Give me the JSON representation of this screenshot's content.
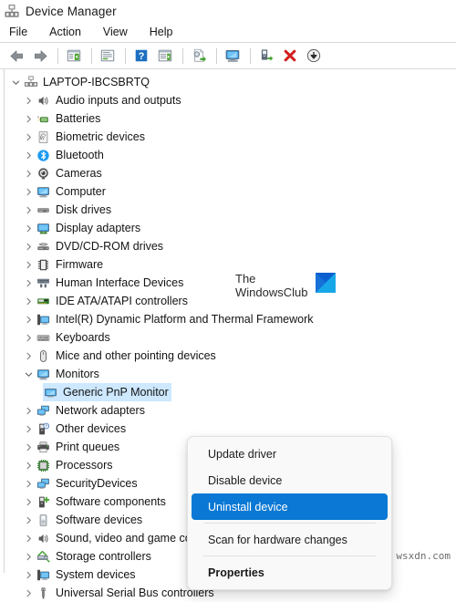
{
  "window": {
    "title": "Device Manager",
    "app_icon": "device-manager-icon"
  },
  "menubar": {
    "items": [
      {
        "label": "File",
        "name": "menu-file"
      },
      {
        "label": "Action",
        "name": "menu-action"
      },
      {
        "label": "View",
        "name": "menu-view"
      },
      {
        "label": "Help",
        "name": "menu-help"
      }
    ]
  },
  "toolbar": {
    "buttons": [
      {
        "icon": "back-arrow-icon",
        "title": "Back"
      },
      {
        "icon": "forward-arrow-icon",
        "title": "Forward"
      },
      {
        "icon": "show-hide-console-tree-icon",
        "title": "Show/hide console tree"
      },
      {
        "icon": "properties-icon",
        "title": "Properties"
      },
      {
        "icon": "help-icon",
        "title": "Help"
      },
      {
        "icon": "show-hide-action-pane-icon",
        "title": "Show/hide action pane"
      },
      {
        "icon": "update-driver-icon",
        "title": "Update driver"
      },
      {
        "icon": "scan-hardware-changes-icon",
        "title": "Scan for hardware changes"
      },
      {
        "icon": "enable-device-icon",
        "title": "Enable device"
      },
      {
        "icon": "uninstall-device-icon",
        "title": "Uninstall device"
      },
      {
        "icon": "disable-device-icon",
        "title": "Disable device"
      }
    ]
  },
  "tree": {
    "root": {
      "label": "LAPTOP-IBCSBRTQ",
      "icon": "computer-node-icon",
      "expanded": true
    },
    "items": [
      {
        "label": "Audio inputs and outputs",
        "icon": "speaker-icon"
      },
      {
        "label": "Batteries",
        "icon": "battery-icon"
      },
      {
        "label": "Biometric devices",
        "icon": "fingerprint-icon"
      },
      {
        "label": "Bluetooth",
        "icon": "bluetooth-icon"
      },
      {
        "label": "Cameras",
        "icon": "camera-icon"
      },
      {
        "label": "Computer",
        "icon": "monitor-icon"
      },
      {
        "label": "Disk drives",
        "icon": "disk-drive-icon"
      },
      {
        "label": "Display adapters",
        "icon": "display-adapter-icon"
      },
      {
        "label": "DVD/CD-ROM drives",
        "icon": "optical-drive-icon"
      },
      {
        "label": "Firmware",
        "icon": "firmware-chip-icon"
      },
      {
        "label": "Human Interface Devices",
        "icon": "hid-icon"
      },
      {
        "label": "IDE ATA/ATAPI controllers",
        "icon": "ide-controller-icon"
      },
      {
        "label": "Intel(R) Dynamic Platform and Thermal Framework",
        "icon": "thermal-framework-icon"
      },
      {
        "label": "Keyboards",
        "icon": "keyboard-icon"
      },
      {
        "label": "Mice and other pointing devices",
        "icon": "mouse-icon"
      },
      {
        "label": "Monitors",
        "icon": "monitor-icon",
        "expanded": true,
        "children": [
          {
            "label": "Generic PnP Monitor",
            "icon": "monitor-small-icon",
            "selected": true
          }
        ]
      },
      {
        "label": "Network adapters",
        "icon": "network-adapter-icon"
      },
      {
        "label": "Other devices",
        "icon": "other-device-icon"
      },
      {
        "label": "Print queues",
        "icon": "printer-icon"
      },
      {
        "label": "Processors",
        "icon": "processor-icon"
      },
      {
        "label": "SecurityDevices",
        "icon": "security-device-icon"
      },
      {
        "label": "Software components",
        "icon": "software-component-icon"
      },
      {
        "label": "Software devices",
        "icon": "software-device-icon"
      },
      {
        "label": "Sound, video and game controllers",
        "icon": "speaker-icon"
      },
      {
        "label": "Storage controllers",
        "icon": "storage-controller-icon"
      },
      {
        "label": "System devices",
        "icon": "system-device-icon"
      },
      {
        "label": "Universal Serial Bus controllers",
        "icon": "usb-icon"
      }
    ]
  },
  "context_menu": {
    "items": [
      {
        "label": "Update driver",
        "type": "item",
        "name": "ctx-update-driver"
      },
      {
        "label": "Disable device",
        "type": "item",
        "name": "ctx-disable-device"
      },
      {
        "label": "Uninstall device",
        "type": "item",
        "name": "ctx-uninstall-device",
        "highlighted": true
      },
      {
        "type": "separator"
      },
      {
        "label": "Scan for hardware changes",
        "type": "item",
        "name": "ctx-scan-hardware-changes"
      },
      {
        "type": "separator"
      },
      {
        "label": "Properties",
        "type": "item",
        "name": "ctx-properties",
        "bold": true
      }
    ]
  },
  "watermark": {
    "line1": "The",
    "line2": "WindowsClub",
    "logo": "windowsclub-logo-icon"
  },
  "footer": {
    "text": "wsxdn.com"
  },
  "colors": {
    "selection": "#cde8ff",
    "menu_highlight": "#0a78d4",
    "accent_blue": "#0a78d4"
  }
}
